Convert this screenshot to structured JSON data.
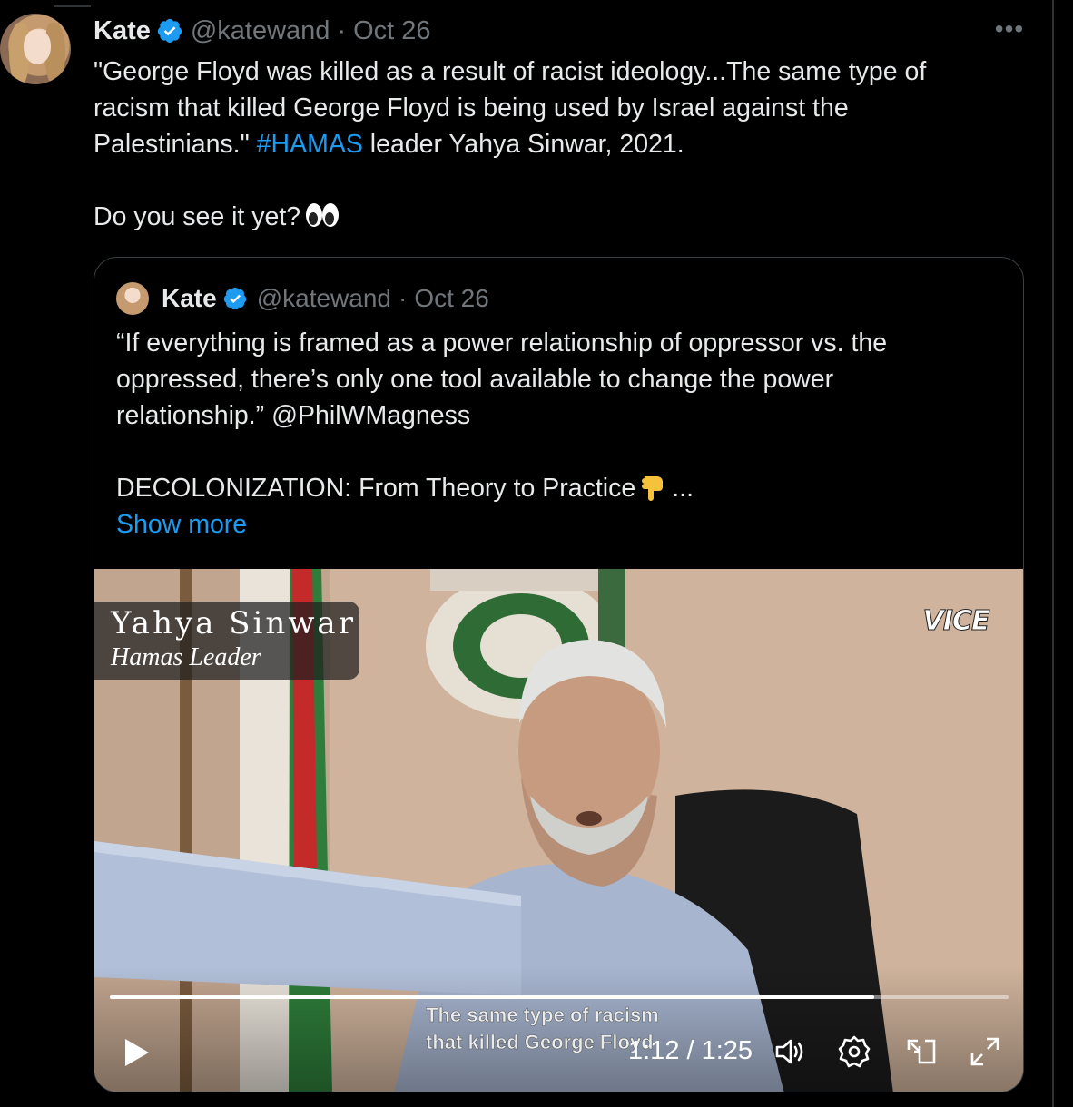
{
  "tweet": {
    "author_name": "Kate",
    "handle": "@katewand",
    "separator": "·",
    "date": "Oct 26",
    "more_label": "•••",
    "text_line1": "\"George Floyd was killed as a result of racist ideology...The same type of",
    "text_line2": "racism that killed George Floyd is being used by Israel against the",
    "text_line3_before": "Palestinians.\" ",
    "hashtag": "#HAMAS",
    "text_line3_after": " leader Yahya Sinwar, 2021.",
    "text_line4": "Do you see it yet?",
    "emoji": "eyes-icon"
  },
  "quote": {
    "author_name": "Kate",
    "handle": "@katewand",
    "separator": "·",
    "date": "Oct 26",
    "text_line1": "“If everything is framed as a power relationship of oppressor vs. the",
    "text_line2": "oppressed, there’s only one tool available to change the power",
    "text_line3": "relationship.” @PhilWMagness",
    "text_line4": "DECOLONIZATION: From Theory to Practice",
    "emoji": "pointing-down-icon",
    "ellipsis": "...",
    "show_more": "Show more"
  },
  "video": {
    "name_tag_title": "Yahya Sinwar",
    "name_tag_subtitle": "Hamas Leader",
    "watermark": "VICE",
    "subtitle_line1": "The same type of racism",
    "subtitle_line2": "that killed George Floyd",
    "time_display": "1:12 / 1:25",
    "progress_fraction": 0.85,
    "controls": [
      "play-icon",
      "volume-icon",
      "settings-icon",
      "pip-icon",
      "fullscreen-icon"
    ]
  },
  "colors": {
    "background": "#000000",
    "text": "#e7e9ea",
    "muted": "#71767b",
    "link": "#1d9bf0",
    "verified": "#1d9bf0"
  }
}
